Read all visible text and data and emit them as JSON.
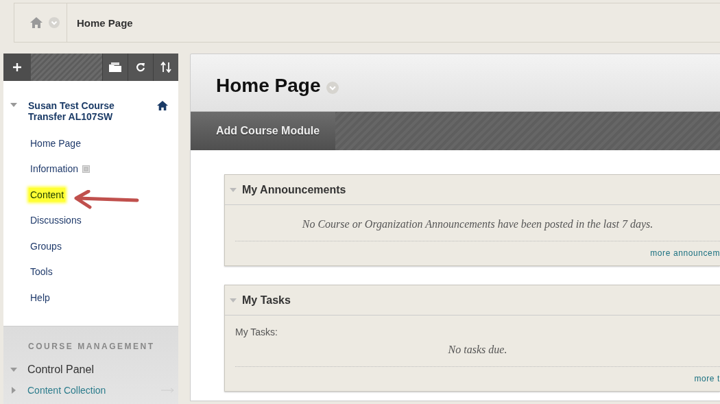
{
  "breadcrumb": {
    "label": "Home Page"
  },
  "sidebar": {
    "course_title": "Susan Test Course Transfer AL107SW",
    "expanded": true,
    "items": [
      {
        "label": "Home Page",
        "kind": "link",
        "highlighted": false
      },
      {
        "label": "Information",
        "kind": "link-with-icon",
        "highlighted": false
      },
      {
        "label": "Content",
        "kind": "link",
        "highlighted": true
      },
      {
        "label": "Discussions",
        "kind": "link",
        "highlighted": false
      },
      {
        "label": "Groups",
        "kind": "link",
        "highlighted": false
      },
      {
        "label": "Tools",
        "kind": "link",
        "highlighted": false
      },
      {
        "label": "Help",
        "kind": "link",
        "highlighted": false
      }
    ],
    "management": {
      "heading": "COURSE MANAGEMENT",
      "panel": {
        "label": "Control Panel",
        "expanded": true
      },
      "items": [
        {
          "label": "Content Collection",
          "expanded": false
        }
      ]
    }
  },
  "page": {
    "title": "Home Page",
    "action_button": "Add Course Module",
    "modules": [
      {
        "title": "My Announcements",
        "expanded": true,
        "message": "No Course or Organization Announcements have been posted in the last 7 days.",
        "more_link": "more announcem"
      },
      {
        "title": "My Tasks",
        "expanded": true,
        "label": "My Tasks:",
        "message": "No tasks due.",
        "more_link": "more t"
      }
    ]
  }
}
